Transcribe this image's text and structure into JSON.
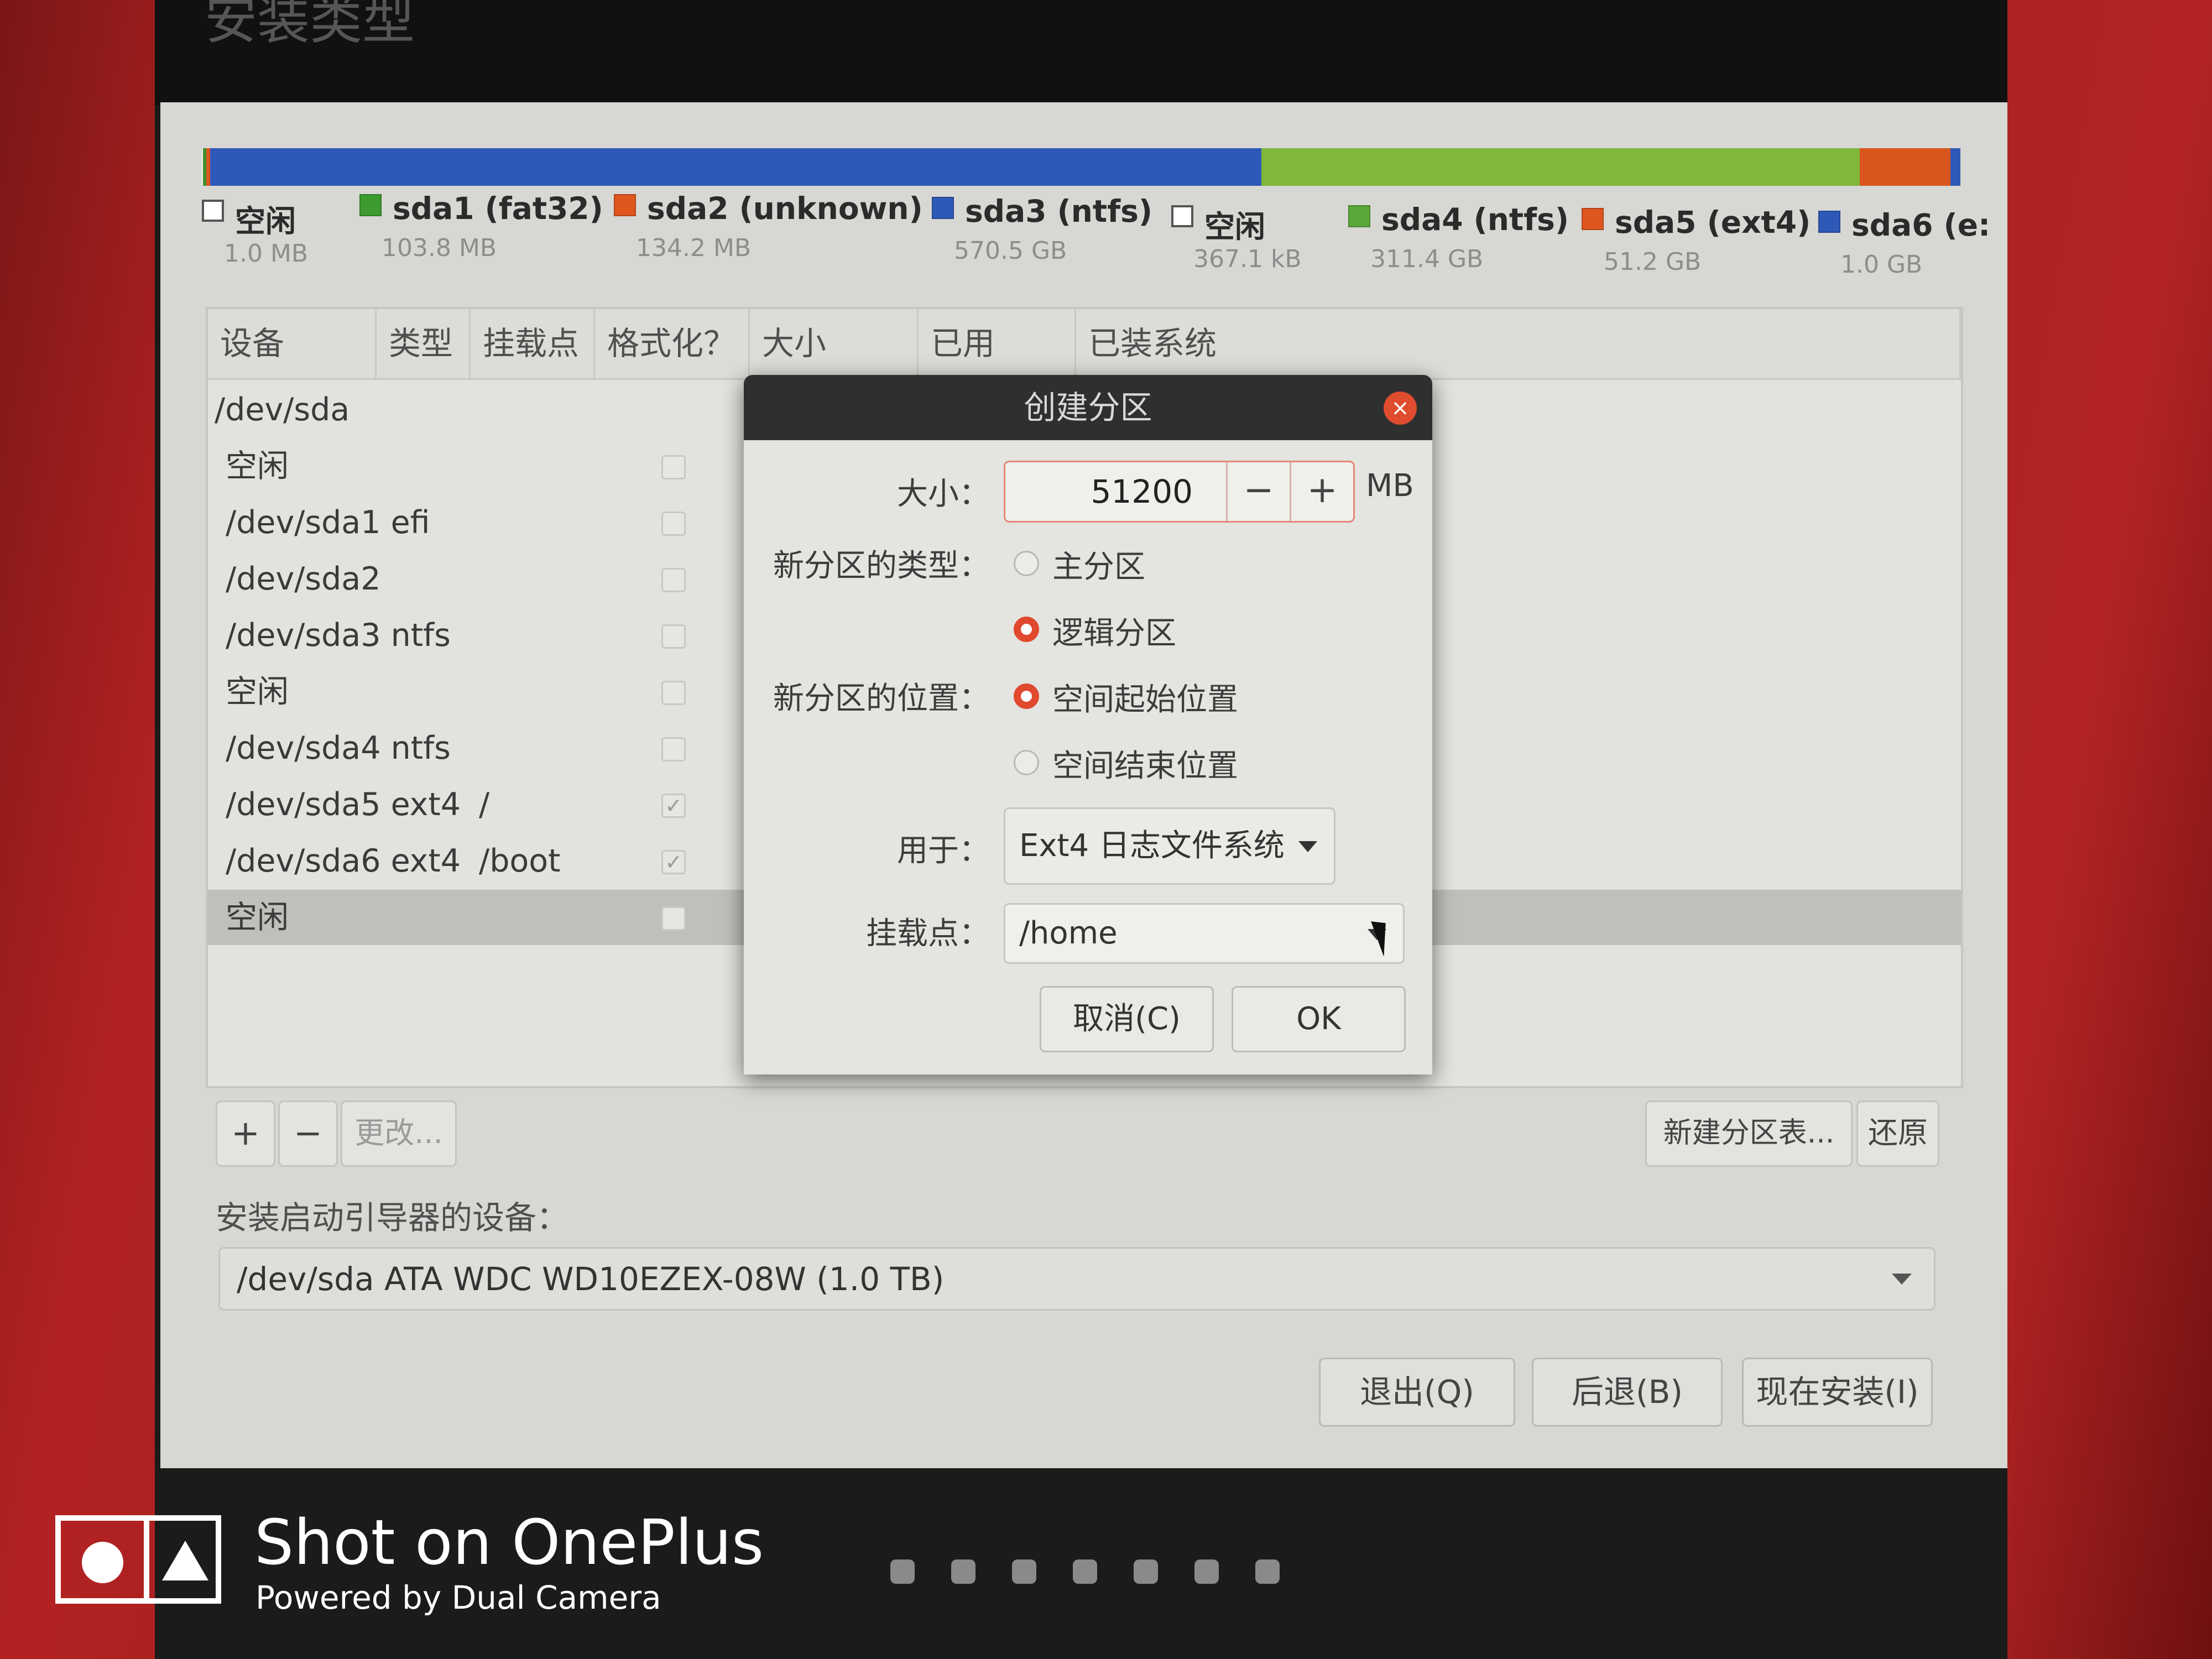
{
  "page_title": "安装类型",
  "partition_bar": {
    "segments": [
      {
        "color": "#f2f2ee",
        "fraction": 0.0005
      },
      {
        "color": "#3d8f2f",
        "fraction": 0.002
      },
      {
        "color": "#d9561f",
        "fraction": 0.002
      },
      {
        "color": "#2f59b8",
        "fraction": 0.58
      },
      {
        "color": "#7fb83a",
        "fraction": 0.33
      },
      {
        "color": "#d9561f",
        "fraction": 0.05
      },
      {
        "color": "#2f59b8",
        "fraction": 0.0055
      }
    ]
  },
  "legend": [
    {
      "name": "空闲",
      "size": "1.0 MB",
      "color": "#ffffff"
    },
    {
      "name": "sda1 (fat32)",
      "size": "103.8 MB",
      "color": "#3d9a2f"
    },
    {
      "name": "sda2 (unknown)",
      "size": "134.2 MB",
      "color": "#e0561f"
    },
    {
      "name": "sda3 (ntfs)",
      "size": "570.5 GB",
      "color": "#2f59b8"
    },
    {
      "name": "空闲",
      "size": "367.1 kB",
      "color": "#ffffff"
    },
    {
      "name": "sda4 (ntfs)",
      "size": "311.4 GB",
      "color": "#5aa83a"
    },
    {
      "name": "sda5 (ext4)",
      "size": "51.2 GB",
      "color": "#e0561f"
    },
    {
      "name": "sda6 (e:",
      "size": "1.0 GB",
      "color": "#2f59b8"
    }
  ],
  "table": {
    "headers": [
      "设备",
      "类型",
      "挂载点",
      "格式化？",
      "大小",
      "已用",
      "已装系统"
    ],
    "rows": [
      {
        "device": "/dev/sda",
        "mount": "",
        "format": false,
        "selected": false
      },
      {
        "device": "空闲",
        "mount": "",
        "format": false,
        "selected": false
      },
      {
        "device": "/dev/sda1  efi",
        "mount": "",
        "format": false,
        "selected": false
      },
      {
        "device": "/dev/sda2",
        "mount": "",
        "format": false,
        "selected": false
      },
      {
        "device": "/dev/sda3  ntfs",
        "mount": "",
        "format": false,
        "selected": false
      },
      {
        "device": "空闲",
        "mount": "",
        "format": false,
        "selected": false
      },
      {
        "device": "/dev/sda4  ntfs",
        "mount": "",
        "format": false,
        "selected": false
      },
      {
        "device": "/dev/sda5  ext4",
        "mount": "/",
        "format": true,
        "selected": false
      },
      {
        "device": "/dev/sda6  ext4",
        "mount": "/boot",
        "format": true,
        "selected": false
      },
      {
        "device": "空闲",
        "mount": "",
        "format": false,
        "selected": true
      }
    ]
  },
  "table_buttons": {
    "add": "+",
    "remove": "−",
    "change": "更改...",
    "new_table": "新建分区表...",
    "revert": "还原"
  },
  "boot": {
    "label": "安装启动引导器的设备：",
    "value": "/dev/sda   ATA WDC WD10EZEX-08W (1.0 TB)"
  },
  "nav": {
    "quit": "退出(Q)",
    "back": "后退(B)",
    "install": "现在安装(I)"
  },
  "dialog": {
    "title": "创建分区",
    "close_icon": "×",
    "size_label": "大小：",
    "size_value": "51200",
    "size_minus": "−",
    "size_plus": "+",
    "size_unit": "MB",
    "type_label": "新分区的类型：",
    "type_primary": "主分区",
    "type_logical": "逻辑分区",
    "type_selected": "logical",
    "location_label": "新分区的位置：",
    "location_start": "空间起始位置",
    "location_end": "空间结束位置",
    "location_selected": "start",
    "use_label": "用于：",
    "use_value": "Ext4 日志文件系统",
    "mount_label": "挂载点：",
    "mount_value": "/home",
    "cancel": "取消(C)",
    "ok": "OK"
  },
  "watermark": {
    "title": "Shot on OnePlus",
    "subtitle": "Powered by Dual Camera"
  },
  "pager_dots": 7
}
